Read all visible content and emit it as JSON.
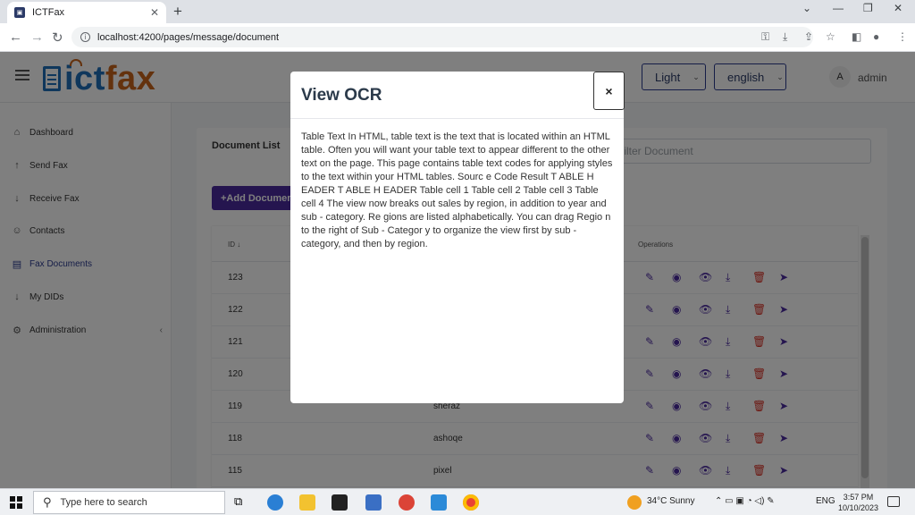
{
  "browser": {
    "tab_title": "ICTFax",
    "tab_close": "✕",
    "new_tab": "+",
    "url": "localhost:4200/pages/message/document",
    "controls": {
      "minimize": "⌄",
      "restore": "—",
      "maximize": "❐",
      "close": "✕"
    }
  },
  "app": {
    "logo_ict": "ict",
    "logo_fax": "fax",
    "theme_select": "Light",
    "language_select": "english",
    "avatar_initial": "A",
    "user_name": "admin"
  },
  "sidebar": {
    "items": [
      {
        "label": "Dashboard",
        "icon": "⌂"
      },
      {
        "label": "Send Fax",
        "icon": "↑"
      },
      {
        "label": "Receive Fax",
        "icon": "↓"
      },
      {
        "label": "Contacts",
        "icon": "☺"
      },
      {
        "label": "Fax Documents",
        "icon": "▤"
      },
      {
        "label": "My DIDs",
        "icon": "↓"
      },
      {
        "label": "Administration",
        "icon": "⚙",
        "caret": "‹"
      }
    ]
  },
  "document_list": {
    "title": "Document List",
    "filter_placeholder": "Filter Document",
    "add_button": "+Add Document",
    "col_id": "ID ↓",
    "col_operations": "Operations",
    "rows": [
      {
        "id": "123",
        "name": ""
      },
      {
        "id": "122",
        "name": ""
      },
      {
        "id": "121",
        "name": ""
      },
      {
        "id": "120",
        "name": ""
      },
      {
        "id": "119",
        "name": "sheraz"
      },
      {
        "id": "118",
        "name": "ashoqe"
      },
      {
        "id": "115",
        "name": "pixel"
      }
    ],
    "op_icons": [
      "✎",
      "◉",
      "👁",
      "⤓",
      "🗑",
      "➤"
    ]
  },
  "modal": {
    "title": "View OCR",
    "close": "×",
    "body": "Table Text In HTML, table text is the text that is located within an HTML table. Often you will want your table text to appear different to the other text on the page. This page contains table text codes for applying styles to the text within your HTML tables. Sourc e Code Result T ABLE H EADER T ABLE H EADER Table cell 1 Table cell 2 Table cell 3 Table cell 4 The view now breaks out sales by region, in addition to year and sub - category. Re gions are listed alphabetically. You can drag Regio n to the right of Sub - Categor y to organize the view first by sub - category, and then by region."
  },
  "taskbar": {
    "search_placeholder": "Type here to search",
    "weather": "34°C  Sunny",
    "lang": "ENG",
    "time": "3:57 PM",
    "date": "10/10/2023"
  },
  "colors": {
    "primary": "#4a2a9f",
    "danger": "#d93025",
    "logo_blue": "#1f6fb8",
    "logo_orange": "#c8641b"
  }
}
